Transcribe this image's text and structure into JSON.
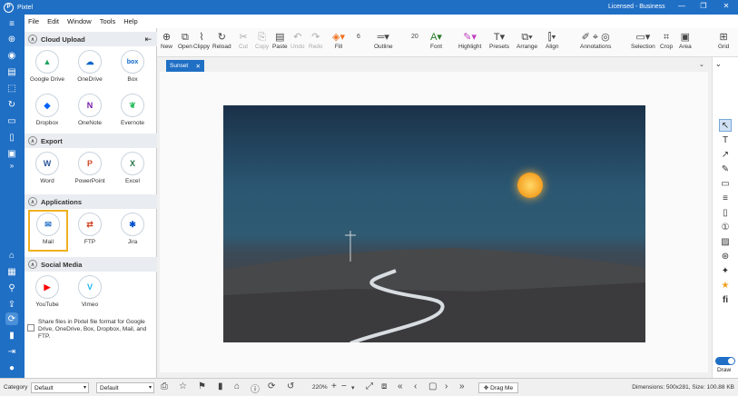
{
  "window": {
    "title": "Pixtel",
    "license": "Licensed - Business",
    "minimize": "—",
    "maximize": "❐",
    "close": "✕"
  },
  "menu": [
    "File",
    "Edit",
    "Window",
    "Tools",
    "Help"
  ],
  "left_nav_icons": [
    "home-icon",
    "gallery-icon",
    "search-icon",
    "export-icon",
    "share-icon",
    "phone-icon",
    "login-icon",
    "user-icon"
  ],
  "panel": {
    "sections": [
      {
        "title": "Cloud Upload",
        "items": [
          "Google Drive",
          "OneDrive",
          "Box",
          "Dropbox",
          "OneNote",
          "Evernote"
        ]
      },
      {
        "title": "Export",
        "items": [
          "Word",
          "PowerPoint",
          "Excel"
        ]
      },
      {
        "title": "Applications",
        "items": [
          "Mail",
          "FTP",
          "Jira"
        ]
      },
      {
        "title": "Social Media",
        "items": [
          "YouTube",
          "Vimeo"
        ]
      }
    ],
    "footnote": "Share files in Pixtel file format for Google Drive, OneDrive, Box, Dropbox, Mail, and FTP."
  },
  "toolbar": {
    "new": "New",
    "open": "Open",
    "clippy": "Clippy",
    "reload": "Reload",
    "cut": "Cut",
    "copy": "Copy",
    "paste": "Paste",
    "undo": "Undo",
    "redo": "Redo",
    "fill": "Fill",
    "outline": "Outline",
    "font": "Font",
    "highlight": "Highlight",
    "presets": "Presets",
    "arrange": "Arrange",
    "align": "Align",
    "annotations": "Annotations",
    "selection": "Selection",
    "crop": "Crop",
    "area": "Area",
    "grid": "Grid",
    "outline_size": "6",
    "font_size": "20"
  },
  "tab": {
    "label": "Sunset",
    "close": "✕"
  },
  "statusbar": {
    "category_label": "Category",
    "category_value": "Default",
    "second_value": "Default",
    "zoom": "220%",
    "drag_me": "Drag Me",
    "dimensions": "Dimensions: 500x281, Size: 100.88 KB"
  },
  "rightbar": {
    "draw_label": "Draw"
  },
  "colors": {
    "accent": "#1f6fc5",
    "selection": "#f0b020"
  }
}
